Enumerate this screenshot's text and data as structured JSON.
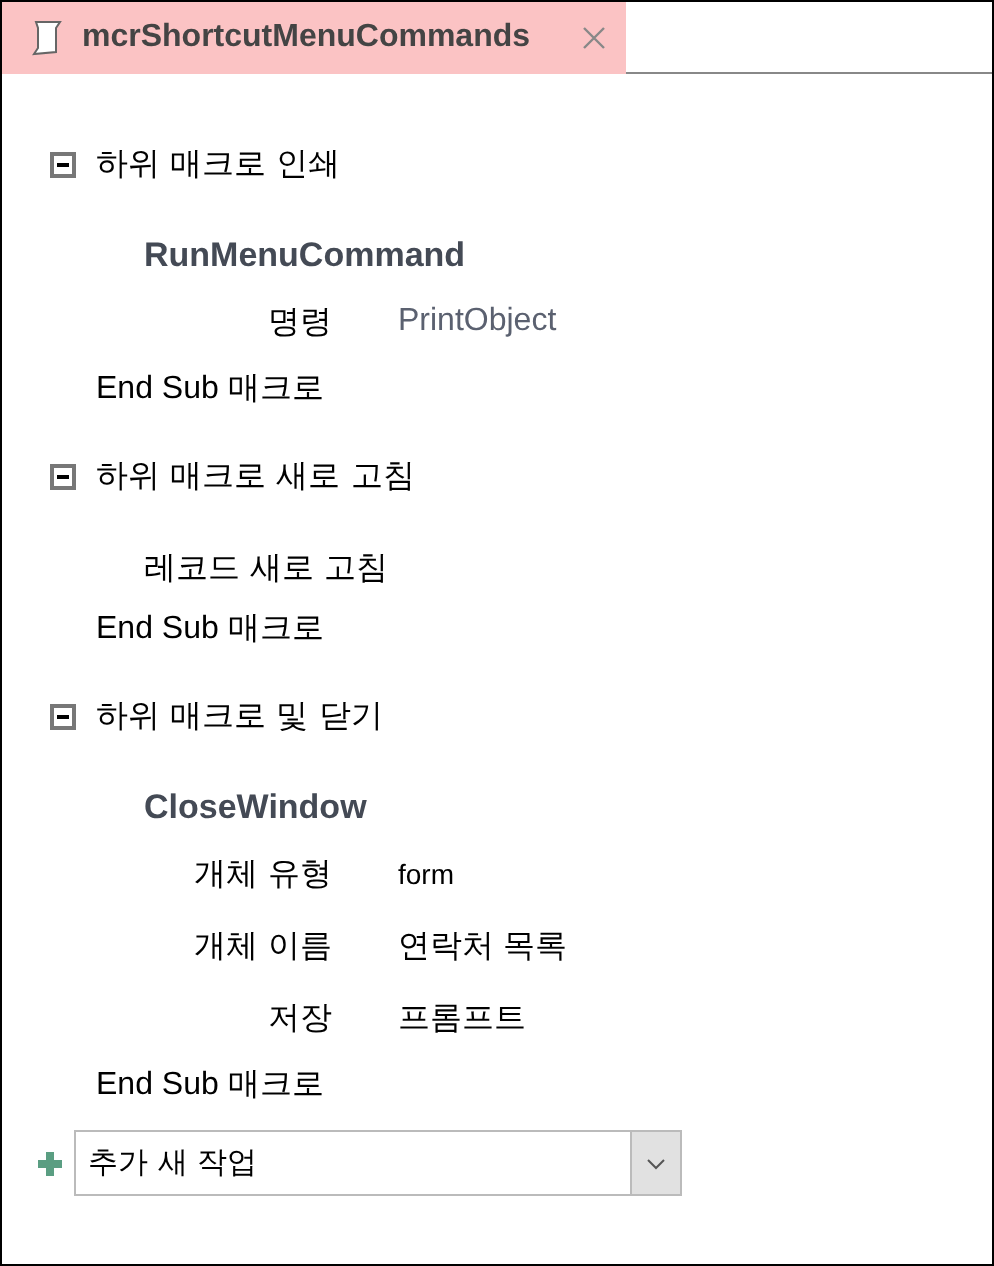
{
  "tab": {
    "title": "mcrShortcutMenuCommands",
    "selected": true
  },
  "submacros": [
    {
      "title": "하위 매크로 인쇄",
      "expanded": true,
      "actions": [
        {
          "kind": "command",
          "name": "RunMenuCommand",
          "arguments": [
            {
              "label": "명령",
              "value": "PrintObject",
              "kind": "muted"
            }
          ]
        }
      ],
      "end": "End Sub 매크로"
    },
    {
      "title": "하위 매크로 새로 고침",
      "expanded": true,
      "actions": [
        {
          "kind": "plain",
          "name": "레코드 새로 고침"
        }
      ],
      "end": "End Sub 매크로"
    },
    {
      "title": "하위 매크로 및 닫기",
      "expanded": true,
      "actions": [
        {
          "kind": "command",
          "name": "CloseWindow",
          "arguments": [
            {
              "label": "개체 유형",
              "value": "form",
              "kind": "small"
            },
            {
              "label": "개체 이름",
              "value": "연락처 목록",
              "kind": "text"
            },
            {
              "label": "저장",
              "value": "프롬프트",
              "kind": "text"
            }
          ]
        }
      ],
      "end": "End Sub 매크로"
    }
  ],
  "add_action": {
    "value": "추가 새 작업"
  }
}
